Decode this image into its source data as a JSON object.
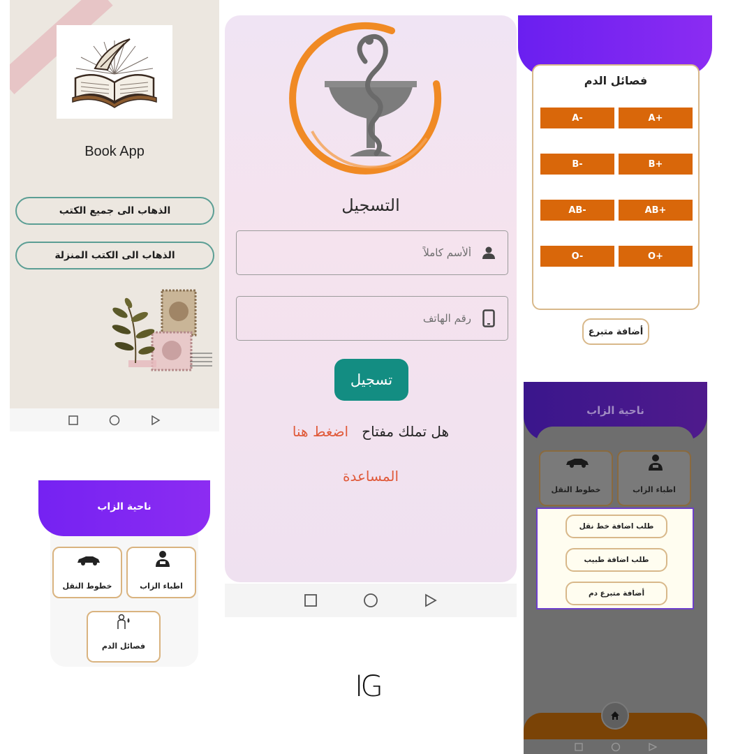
{
  "book_app": {
    "title": "Book App",
    "btn_all_books": "الذهاب الى جميع الكتب",
    "btn_downloaded": "الذهاب الى الكتب المنزلة",
    "logo_icon": "open-book-quill-icon",
    "accent": "#5b9e94"
  },
  "register": {
    "title": "التسجيل",
    "name_placeholder": "ألأسم كاملاً",
    "phone_placeholder": "رقم الهاتف",
    "submit_label": "تسجيل",
    "have_key_question": "هل تملك مفتاح",
    "press_here": "اضغط هنا",
    "help": "المساعدة",
    "logo_icon": "pharmacy-bowl-snake-icon",
    "button_color": "#138d82",
    "link_color": "#e05a3a",
    "ring_color": "#f08a24"
  },
  "blood": {
    "title": "فصائل الدم",
    "types": [
      "A-",
      "A+",
      "B-",
      "B+",
      "AB-",
      "AB+",
      "O-",
      "O+"
    ],
    "add_donor": "أضافة متبرع",
    "header_color": "#6a1ff0",
    "button_color": "#d9670a"
  },
  "zab_home": {
    "title": "ناحية الزاب",
    "tile_doctors": "اطباء الزاب",
    "tile_transport": "خطوط النقل",
    "tile_blood": "فصائل الدم"
  },
  "zab_dialog": {
    "title": "ناحية الزاب",
    "tile_doctors": "اطباء الزاب",
    "tile_transport": "خطوط النقل",
    "req_transport": "طلب اضافة خط نقل",
    "req_doctor": "طلب اضافة طبيب",
    "add_blood_donor": "أضافة متبرع دم"
  },
  "watermark": "IG"
}
